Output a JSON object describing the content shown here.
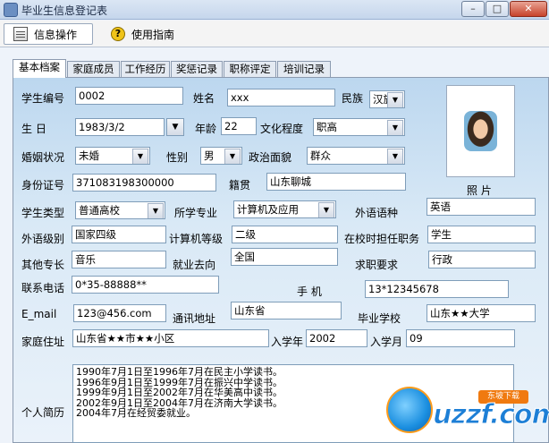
{
  "window": {
    "title": "毕业生信息登记表",
    "controls": {
      "minimize": "–",
      "maximize": "□",
      "close": "✕"
    }
  },
  "menu": {
    "info_label": "信息操作",
    "guide_label": "使用指南"
  },
  "tabs": [
    "基本档案",
    "家庭成员",
    "工作经历",
    "奖惩记录",
    "职称评定",
    "培训记录"
  ],
  "form": {
    "student_no": {
      "label": "学生编号",
      "value": "0002"
    },
    "name": {
      "label": "姓名",
      "value": "xxx"
    },
    "ethnicity": {
      "label": "民族",
      "value": "汉族"
    },
    "birthday": {
      "label": "生    日",
      "value": "1983/3/2"
    },
    "age": {
      "label": "年龄",
      "value": "22"
    },
    "education": {
      "label": "文化程度",
      "value": "职高"
    },
    "marital": {
      "label": "婚姻状况",
      "value": "未婚"
    },
    "gender": {
      "label": "性别",
      "value": "男"
    },
    "politics": {
      "label": "政治面貌",
      "value": "群众"
    },
    "id_no": {
      "label": "身份证号",
      "value": "371083198300000"
    },
    "native": {
      "label": "籍贯",
      "value": "山东聊城"
    },
    "student_type": {
      "label": "学生类型",
      "value": "普通高校"
    },
    "major": {
      "label": "所学专业",
      "value": "计算机及应用"
    },
    "language": {
      "label": "外语语种",
      "value": "英语"
    },
    "lang_level": {
      "label": "外语级别",
      "value": "国家四级"
    },
    "computer_level": {
      "label": "计算机等级",
      "value": "二级"
    },
    "school_post": {
      "label": "在校时担任职务",
      "value": "学生"
    },
    "specialty": {
      "label": "其他专长",
      "value": "音乐"
    },
    "employment": {
      "label": "就业去向",
      "value": "全国"
    },
    "job_request": {
      "label": "求职要求",
      "value": "行政"
    },
    "phone": {
      "label": "联系电话",
      "value": "0*35-88888**"
    },
    "mobile": {
      "label": "手    机",
      "value": "13*12345678"
    },
    "email": {
      "label": "E_mail",
      "value": "123@456.com"
    },
    "address": {
      "label": "通讯地址",
      "value": "山东省"
    },
    "graduate_school": {
      "label": "毕业学校",
      "value": "山东★★大学"
    },
    "home": {
      "label": "家庭住址",
      "value": "山东省★★市★★小区"
    },
    "entry_year": {
      "label": "入学年",
      "value": "2002"
    },
    "entry_month": {
      "label": "入学月",
      "value": "09"
    },
    "photo_label": "照    片",
    "resume": {
      "label": "个人简历",
      "lines": [
        "1990年7月1日至1996年7月在民主小学读书。",
        "1996年9月1日至1999年7月在振兴中学读书。",
        "1999年9月1日至2002年7月在华美高中读书。",
        "2002年9月1日至2004年7月在济南大学读书。",
        "2004年7月在经贸委就业。"
      ]
    }
  },
  "watermark": {
    "text": "uzzf.com",
    "tag": "东坡下载"
  }
}
